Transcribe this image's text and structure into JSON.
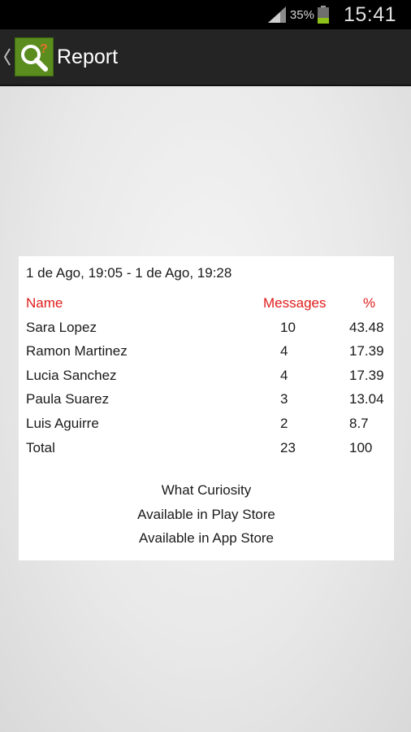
{
  "status_bar": {
    "battery_percent": "35%",
    "clock": "15:41",
    "battery_level": 0.35,
    "icons": [
      "signal-icon",
      "battery-icon"
    ]
  },
  "action_bar": {
    "title": "Report",
    "icons": [
      "back-chevron-icon",
      "app-logo-icon"
    ]
  },
  "report": {
    "date_range": "1 de Ago, 19:05 - 1 de Ago, 19:28",
    "headers": {
      "name": "Name",
      "messages": "Messages",
      "percent": "%"
    },
    "rows": [
      {
        "name": "Sara Lopez",
        "messages": "10",
        "percent": "43.48"
      },
      {
        "name": "Ramon Martinez",
        "messages": "4",
        "percent": "17.39"
      },
      {
        "name": "Lucia Sanchez",
        "messages": "4",
        "percent": "17.39"
      },
      {
        "name": "Paula Suarez",
        "messages": "3",
        "percent": "13.04"
      },
      {
        "name": "Luis Aguirre",
        "messages": "2",
        "percent": "8.7"
      }
    ],
    "total": {
      "name": "Total",
      "messages": "23",
      "percent": "100"
    },
    "footer": [
      "What Curiosity",
      "Available in Play Store",
      "Available in App Store"
    ]
  },
  "colors": {
    "header_text": "#e01b1b",
    "action_bar_bg": "#242424",
    "status_bar_bg": "#000000",
    "logo_green": "#5a8c1e",
    "battery_green": "#8ec21b"
  }
}
